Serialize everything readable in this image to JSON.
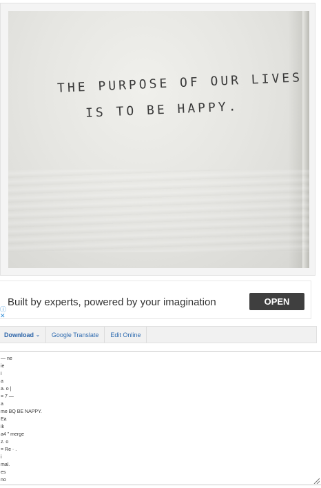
{
  "image": {
    "handwriting_lines": [
      "THE PURPOSE OF OUR LIVES",
      "IS TO BE HAPPY."
    ]
  },
  "ad": {
    "text": "Built by experts, powered by your imagination",
    "button_label": "OPEN"
  },
  "toolbar": {
    "download_label": "Download",
    "translate_label": "Google Translate",
    "edit_label": "Edit Online"
  },
  "ocr_output": {
    "lines": [
      "— ne",
      "ie",
      "i",
      "a",
      "a. o |",
      "= 7 —",
      "a",
      "me BQ BE NAPPY.",
      "Ea",
      "ik",
      "a4 \" merge",
      "z. o",
      "= Re · .",
      "i",
      "mal.",
      "es",
      "no"
    ]
  },
  "colors": {
    "accent": "#2a63a8",
    "ad_button": "#3f3f3f"
  }
}
